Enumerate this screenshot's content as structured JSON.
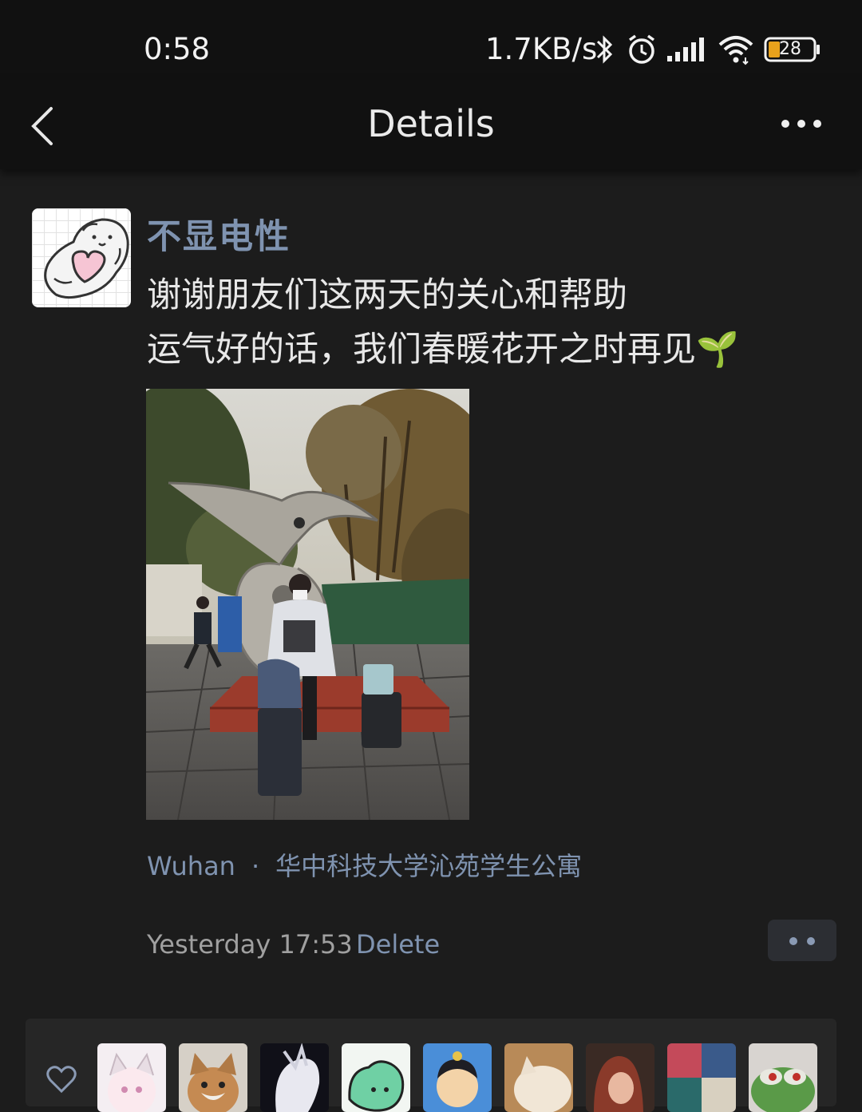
{
  "status_bar": {
    "time": "0:58",
    "network_speed": "1.7KB/s",
    "battery_level": "28",
    "icons": [
      "bluetooth-icon",
      "alarm-icon",
      "signal-icon",
      "wifi-icon",
      "battery-icon"
    ]
  },
  "nav": {
    "title": "Details",
    "back_icon": "chevron-left-icon",
    "more_icon": "more-dots-icon"
  },
  "post": {
    "username": "不显电性",
    "lines": [
      "谢谢朋友们这两天的关心和帮助",
      "运气好的话，我们春暖花开之时再见🌱"
    ],
    "location_city": "Wuhan",
    "location_separator": "·",
    "location_place": "华中科技大学沁苑学生公寓",
    "timestamp": "Yesterday 17:53",
    "delete_label": "Delete"
  },
  "likes": {
    "icon": "heart-icon",
    "avatar_count_visible": 9
  },
  "colors": {
    "background": "#1c1c1c",
    "bar": "#111111",
    "link": "#7f93b0",
    "text": "#e8e8e8",
    "muted": "#a0a0a0"
  }
}
